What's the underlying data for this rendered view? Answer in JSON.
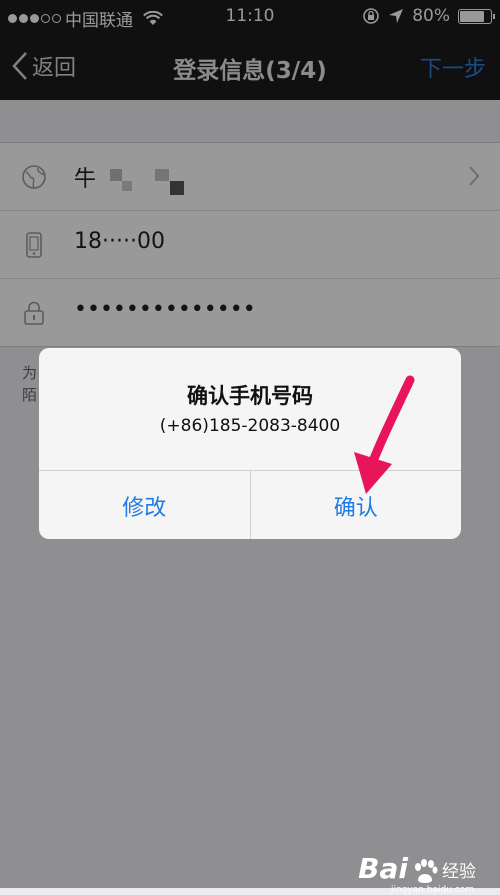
{
  "status_bar": {
    "carrier": "中国联通",
    "time": "11:10",
    "battery_percent": "80%",
    "battery_level": 0.8
  },
  "nav": {
    "back_label": "返回",
    "title": "登录信息(3/4)",
    "next_label": "下一步"
  },
  "form": {
    "name_value": "牛",
    "phone_value": "18·····00",
    "password_value": "••••••••••••••",
    "note_line1": "为",
    "note_line2": "陌"
  },
  "dialog": {
    "title": "确认手机号码",
    "message": "(+86)185-2083-8400",
    "cancel_label": "修改",
    "confirm_label": "确认"
  },
  "watermark": {
    "brand": "Bai",
    "brand_suffix": "经验",
    "url": "jingyan.baidu.com"
  },
  "colors": {
    "accent": "#1e7ce6",
    "annotation_arrow": "#e8155a",
    "nav_background": "#1c1c1c"
  }
}
